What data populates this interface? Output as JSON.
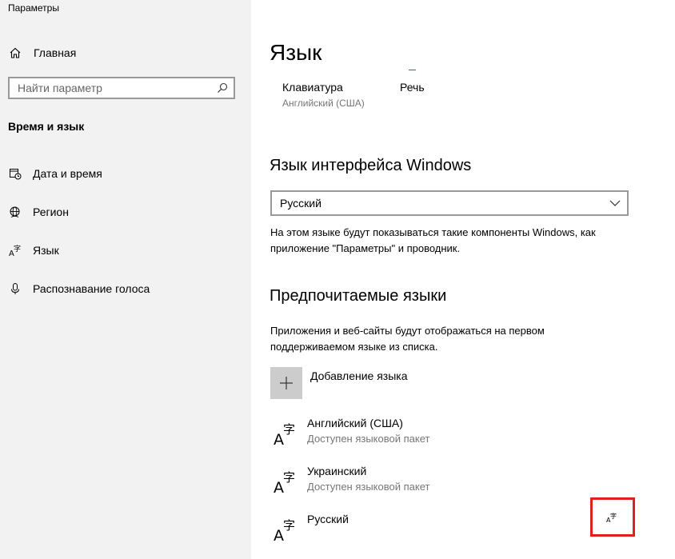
{
  "window": {
    "title": "Параметры"
  },
  "sidebar": {
    "home_label": "Главная",
    "search_placeholder": "Найти параметр",
    "section_title": "Время и язык",
    "items": [
      {
        "label": "Дата и время",
        "icon": "calendar-clock-icon"
      },
      {
        "label": "Регион",
        "icon": "globe-icon"
      },
      {
        "label": "Язык",
        "icon": "language-icon"
      },
      {
        "label": "Распознавание голоса",
        "icon": "microphone-icon"
      }
    ]
  },
  "main": {
    "title": "Язык",
    "quick_links": [
      {
        "title": "Клавиатура",
        "subtitle": "Английский (США)"
      },
      {
        "title": "Речь",
        "subtitle": ""
      }
    ],
    "display_language": {
      "heading": "Язык интерфейса Windows",
      "selected": "Русский",
      "description": "На этом языке будут показываться такие компоненты Windows, как приложение \"Параметры\" и проводник."
    },
    "preferred": {
      "heading": "Предпочитаемые языки",
      "description": "Приложения и веб-сайты будут отображаться на первом поддерживаемом языке из списка.",
      "add_label": "Добавление языка",
      "languages": [
        {
          "name": "Английский (США)",
          "status": "Доступен языковой пакет"
        },
        {
          "name": "Украинский",
          "status": "Доступен языковой пакет"
        },
        {
          "name": "Русский",
          "status": ""
        }
      ]
    }
  },
  "colors": {
    "sidebar_bg": "#f2f2f2",
    "accent": "#0078d7",
    "highlight": "#e02020"
  }
}
